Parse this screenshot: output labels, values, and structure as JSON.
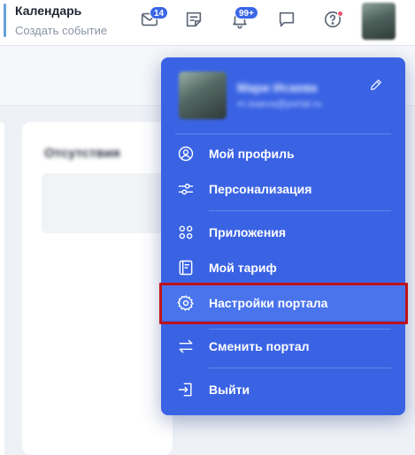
{
  "header": {
    "title": "Календарь",
    "subtitle": "Создать событие",
    "icons": [
      {
        "name": "mail-icon",
        "badge": "14"
      },
      {
        "name": "tasks-icon",
        "badge": ""
      },
      {
        "name": "bell-icon",
        "badge": "99+"
      },
      {
        "name": "chat-icon",
        "badge": ""
      },
      {
        "name": "help-icon",
        "badge": ""
      }
    ],
    "accent_color": "#3a66e6"
  },
  "background": {
    "card_title": "Отсутствия"
  },
  "menu": {
    "user_name": "Мари Исаева",
    "user_email": "m.isaeva@portal.ru",
    "items": [
      {
        "label": "Мой профиль",
        "icon": "user-circle-icon"
      },
      {
        "label": "Персонализация",
        "icon": "sliders-icon"
      },
      {
        "label": "Приложения",
        "icon": "apps-icon"
      },
      {
        "label": "Мой тариф",
        "icon": "tariff-icon"
      },
      {
        "label": "Настройки портала",
        "icon": "gear-icon"
      },
      {
        "label": "Сменить портал",
        "icon": "switch-arrows-icon"
      },
      {
        "label": "Выйти",
        "icon": "logout-icon"
      }
    ],
    "highlighted_item": "Настройки портала",
    "background_color": "#3a63e4",
    "highlight_color": "#c0121a"
  }
}
